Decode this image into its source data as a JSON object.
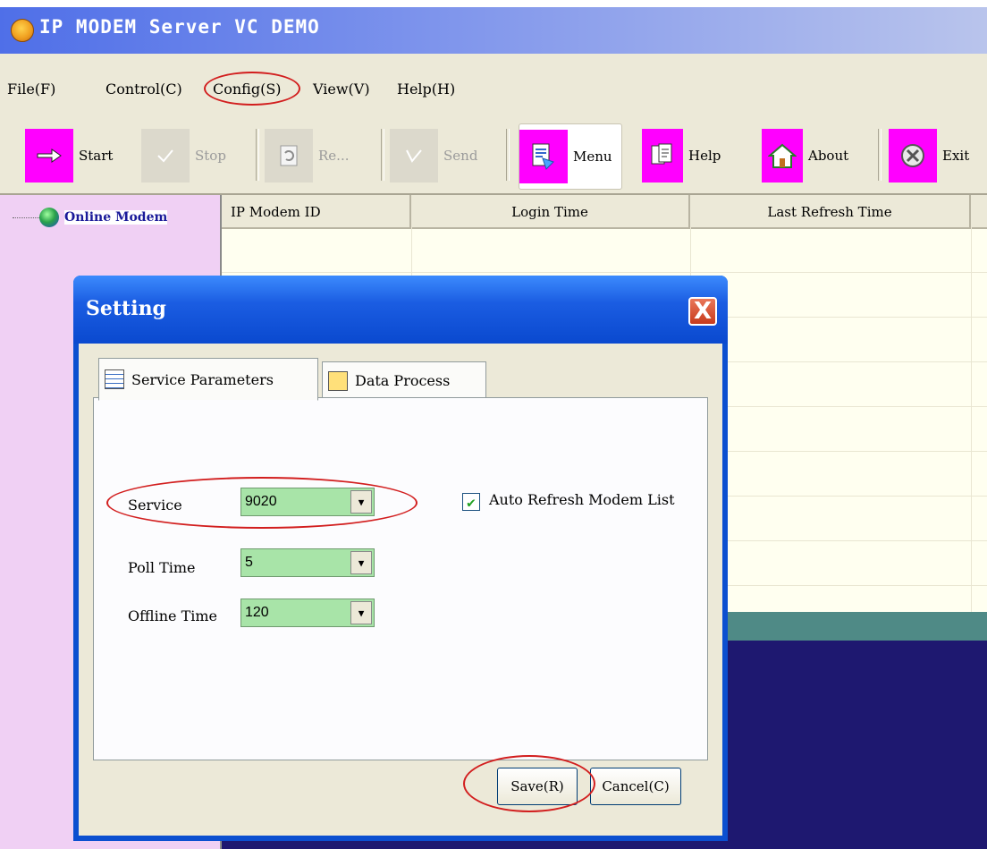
{
  "app": {
    "title": "IP MODEM Server VC DEMO"
  },
  "menu": [
    "File(F)",
    "Control(C)",
    "Config(S)",
    "View(V)",
    "Help(H)"
  ],
  "toolbar": {
    "start": "Start",
    "stop": "Stop",
    "refresh": "Re...",
    "send": "Send",
    "menu": "Menu",
    "help": "Help",
    "about": "About",
    "exit": "Exit"
  },
  "tree": {
    "online_modem": "Online Modem"
  },
  "list": {
    "columns": [
      "IP Modem ID",
      "Login Time",
      "Last Refresh Time"
    ]
  },
  "dialog": {
    "title": "Setting",
    "close_symbol": "X",
    "tabs": [
      "Service Parameters",
      "Data Process"
    ],
    "fields": {
      "service": {
        "label": "Service",
        "value": "9020"
      },
      "poll_time": {
        "label": "Poll Time",
        "value": "5"
      },
      "offline_time": {
        "label": "Offline Time",
        "value": "120"
      }
    },
    "auto_refresh": {
      "label": "Auto Refresh Modem List",
      "checked": true
    },
    "save": "Save(R)",
    "cancel": "Cancel(C)"
  },
  "colors": {
    "highlight": "#d21e1e",
    "toolbar_icon_bg": "#ff00ff",
    "combo_bg": "#a8e4a8"
  },
  "icons": [
    "app-icon",
    "arrow-right-icon",
    "check-icon",
    "refresh-icon",
    "send-icon",
    "menu-icon",
    "help-icon",
    "house-icon",
    "exit-icon",
    "globe-icon",
    "table-icon",
    "document-icon",
    "close-icon",
    "chevron-down-icon"
  ]
}
